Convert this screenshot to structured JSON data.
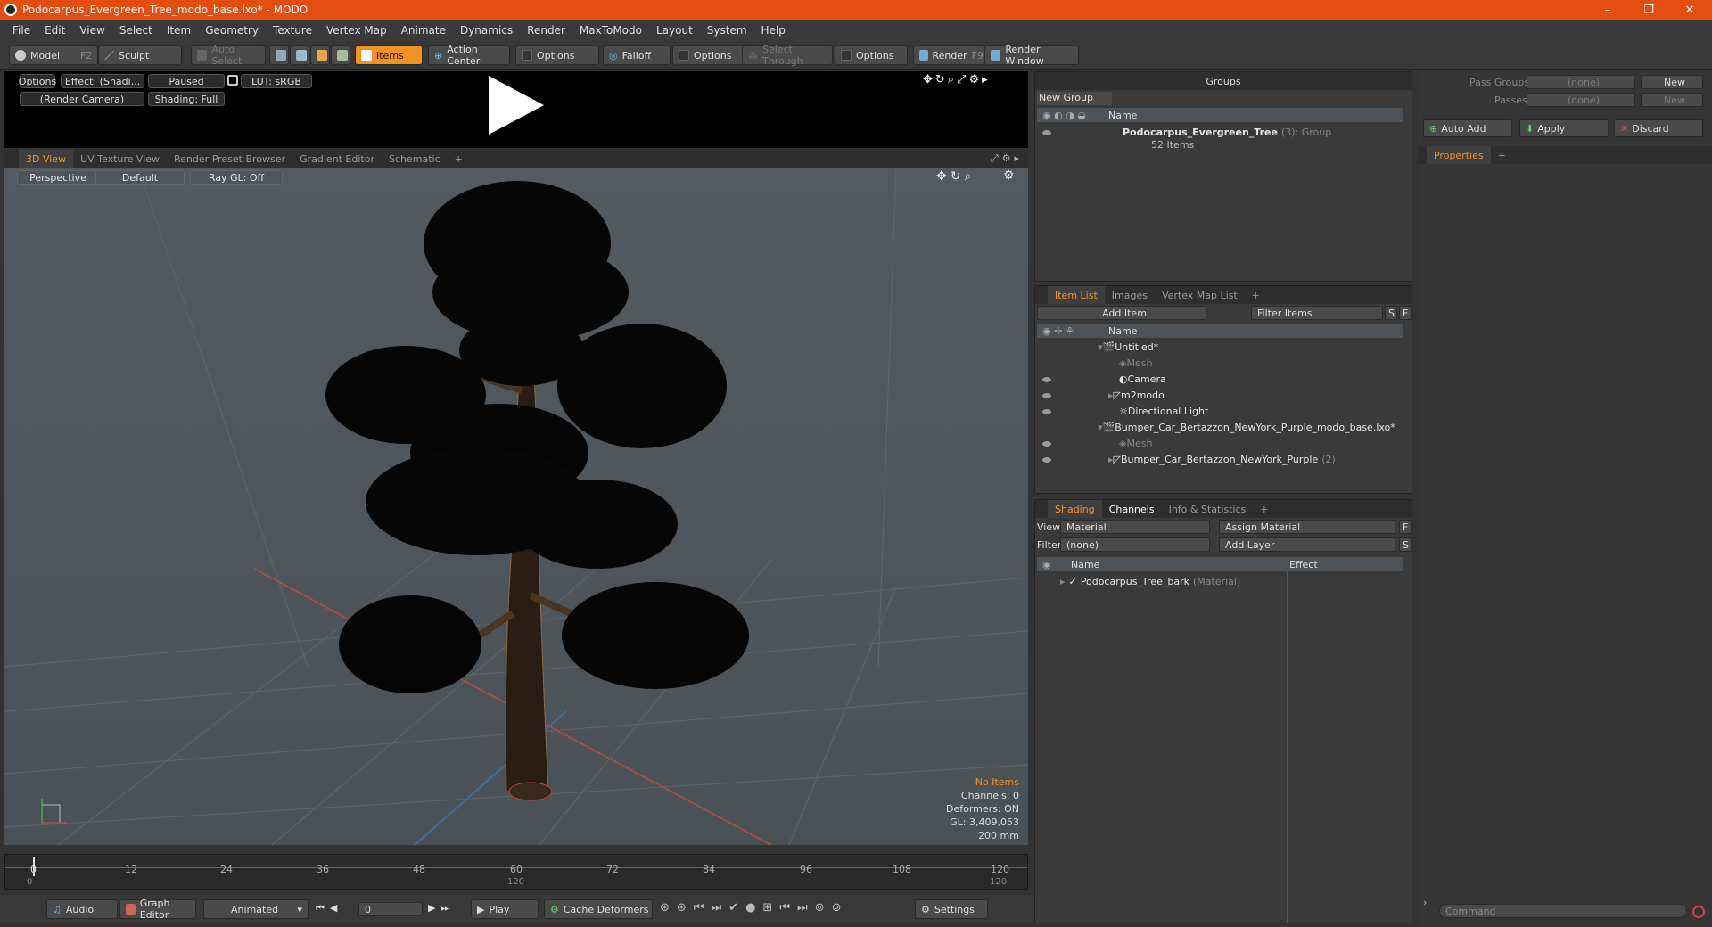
{
  "window": {
    "title": "Podocarpus_Evergreen_Tree_modo_base.lxo* - MODO",
    "minimize": "–",
    "maximize": "❐",
    "close": "✕"
  },
  "menu": [
    "File",
    "Edit",
    "View",
    "Select",
    "Item",
    "Geometry",
    "Texture",
    "Vertex Map",
    "Animate",
    "Dynamics",
    "Render",
    "MaxToModo",
    "Layout",
    "System",
    "Help"
  ],
  "toolbar": {
    "model": "Model",
    "model_key": "F2",
    "sculpt": "Sculpt",
    "auto_select": "Auto Select",
    "items": "Items",
    "action_center": "Action Center",
    "options1": "Options",
    "falloff": "Falloff",
    "options2": "Options",
    "select_through": "Select Through",
    "options3": "Options",
    "render": "Render",
    "render_key": "F9",
    "render_window": "Render Window"
  },
  "preview": {
    "options": "Options",
    "effect": "Effect: (Shadi...",
    "paused": "Paused",
    "lut": "LUT: sRGB",
    "camera": "(Render Camera)",
    "shading": "Shading: Full"
  },
  "viewtabs": {
    "tabs": [
      "3D View",
      "UV Texture View",
      "Render Preset Browser",
      "Gradient Editor",
      "Schematic"
    ],
    "plus": "+"
  },
  "viewport": {
    "perspective": "Perspective",
    "default": "Default",
    "raygl": "Ray GL: Off"
  },
  "stats": {
    "no_items": "No Items",
    "channels": "Channels: 0",
    "deformers": "Deformers: ON",
    "gl": "GL: 3,409,053",
    "scale": "200 mm"
  },
  "timeline": {
    "ticks": [
      "0",
      "12",
      "24",
      "36",
      "48",
      "60",
      "72",
      "84",
      "96",
      "108",
      "120"
    ],
    "lower_ticks": [
      "0",
      "120",
      "120"
    ]
  },
  "bottom": {
    "audio": "Audio",
    "graph_editor": "Graph Editor",
    "animated": "Animated",
    "frame": "0",
    "play": "Play",
    "cache_deformers": "Cache Deformers",
    "settings": "Settings"
  },
  "groups": {
    "title": "Groups",
    "new_group": "New Group",
    "col_name": "Name",
    "item_name": "Podocarpus_Evergreen_Tree",
    "item_count": "(3)",
    "item_type": ": Group",
    "item_sub": "52 Items"
  },
  "itemlist": {
    "tabs": [
      "Item List",
      "Images",
      "Vertex Map List"
    ],
    "plus": "+",
    "add_item": "Add Item",
    "filter": "Filter Items",
    "s": "S",
    "f": "F",
    "col_name": "Name",
    "rows": [
      {
        "label": "Untitled*",
        "muted": false
      },
      {
        "label": "Mesh",
        "muted": true
      },
      {
        "label": "Camera",
        "muted": false
      },
      {
        "label": "m2modo",
        "muted": false
      },
      {
        "label": "Directional Light",
        "muted": false
      },
      {
        "label": "Bumper_Car_Bertazzon_NewYork_Purple_modo_base.lxo*",
        "muted": false
      },
      {
        "label": "Mesh",
        "muted": true
      },
      {
        "label": "Bumper_Car_Bertazzon_NewYork_Purple",
        "muted": false
      }
    ],
    "bumper_count": "(2)"
  },
  "shading": {
    "tabs": [
      "Shading",
      "Channels",
      "Info & Statistics"
    ],
    "plus": "+",
    "view_label": "View",
    "view_value": "Material",
    "assign": "Assign Material",
    "f": "F",
    "filter_label": "Filter",
    "filter_value": "(none)",
    "add_layer": "Add Layer",
    "s": "S",
    "col_name": "Name",
    "col_effect": "Effect",
    "item": "Podocarpus_Tree_bark",
    "item_type": "(Material)"
  },
  "right": {
    "pass_groups": "Pass Groups",
    "passes": "Passes",
    "none1": "(none)",
    "none2": "(none)",
    "new1": "New",
    "new2": "New",
    "auto_add": "Auto Add",
    "apply": "Apply",
    "discard": "Discard",
    "properties": "Properties",
    "plus": "+",
    "command": "Command"
  }
}
